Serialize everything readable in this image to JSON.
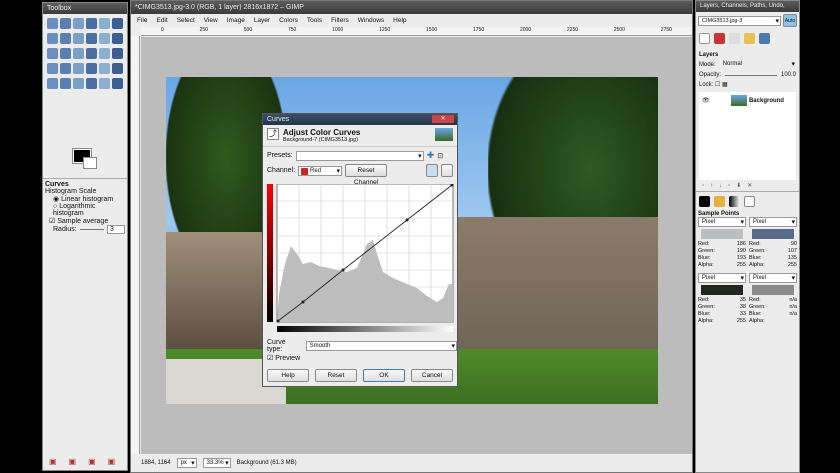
{
  "toolbox": {
    "title": "Toolbox",
    "curves_title": "Curves",
    "histogram_scale": "Histogram Scale",
    "linear": "Linear histogram",
    "logarithmic": "Logarithmic histogram",
    "sample_average": "Sample average",
    "radius_label": "Radius:",
    "radius_value": "3"
  },
  "window": {
    "title": "*CIMG3513.jpg-3.0 (RGB, 1 layer) 2816x1872 – GIMP",
    "menu": [
      "File",
      "Edit",
      "Select",
      "View",
      "Image",
      "Layer",
      "Colors",
      "Tools",
      "Filters",
      "Windows",
      "Help"
    ]
  },
  "ruler": [
    "0",
    "250",
    "500",
    "750",
    "1000",
    "1250",
    "1500",
    "1750",
    "2000",
    "2250",
    "2500",
    "2750"
  ],
  "status": {
    "coords": "1884, 1164",
    "unit": "px",
    "zoom": "33.3%",
    "info": "Background (61.3 MB)"
  },
  "curves": {
    "title": "Curves",
    "heading": "Adjust Color Curves",
    "subheading": "Background-7 (CIMG3513.jpg)",
    "presets_label": "Presets:",
    "channel_label": "Channel:",
    "channel_value": "Red",
    "reset_channel": "Reset Channel",
    "curve_type_label": "Curve type:",
    "curve_type_value": "Smooth",
    "preview_label": "Preview",
    "buttons": {
      "help": "Help",
      "reset": "Reset",
      "ok": "OK",
      "cancel": "Cancel"
    },
    "channel_color": "#cc2222"
  },
  "layers": {
    "tab_title": "Layers, Channels, Paths, Undo, Histog...",
    "image": "CIMG3513.jpg-3",
    "auto": "Auto",
    "heading": "Layers",
    "mode_label": "Mode:",
    "mode_value": "Normal",
    "opacity_label": "Opacity:",
    "opacity_value": "100.0",
    "lock_label": "Lock:",
    "layer_name": "Background"
  },
  "sample_points": {
    "heading": "Sample Points",
    "points": [
      {
        "mode": "Pixel",
        "color": "#bcbec1",
        "red": "186",
        "green": "190",
        "blue": "193",
        "alpha": "255"
      },
      {
        "mode": "Pixel",
        "color": "#5a6a8a",
        "red": "90",
        "green": "107",
        "blue": "135",
        "alpha": "255"
      },
      {
        "mode": "Pixel",
        "color": "#232621",
        "red": "35",
        "green": "38",
        "blue": "33",
        "alpha": "255"
      },
      {
        "mode": "Pixel",
        "color": "#8a8a8a",
        "red": "n/a",
        "green": "n/a",
        "blue": "n/a",
        "alpha": ""
      }
    ],
    "labels": {
      "red": "Red:",
      "green": "Green:",
      "blue": "Blue:",
      "alpha": "Alpha:"
    }
  }
}
